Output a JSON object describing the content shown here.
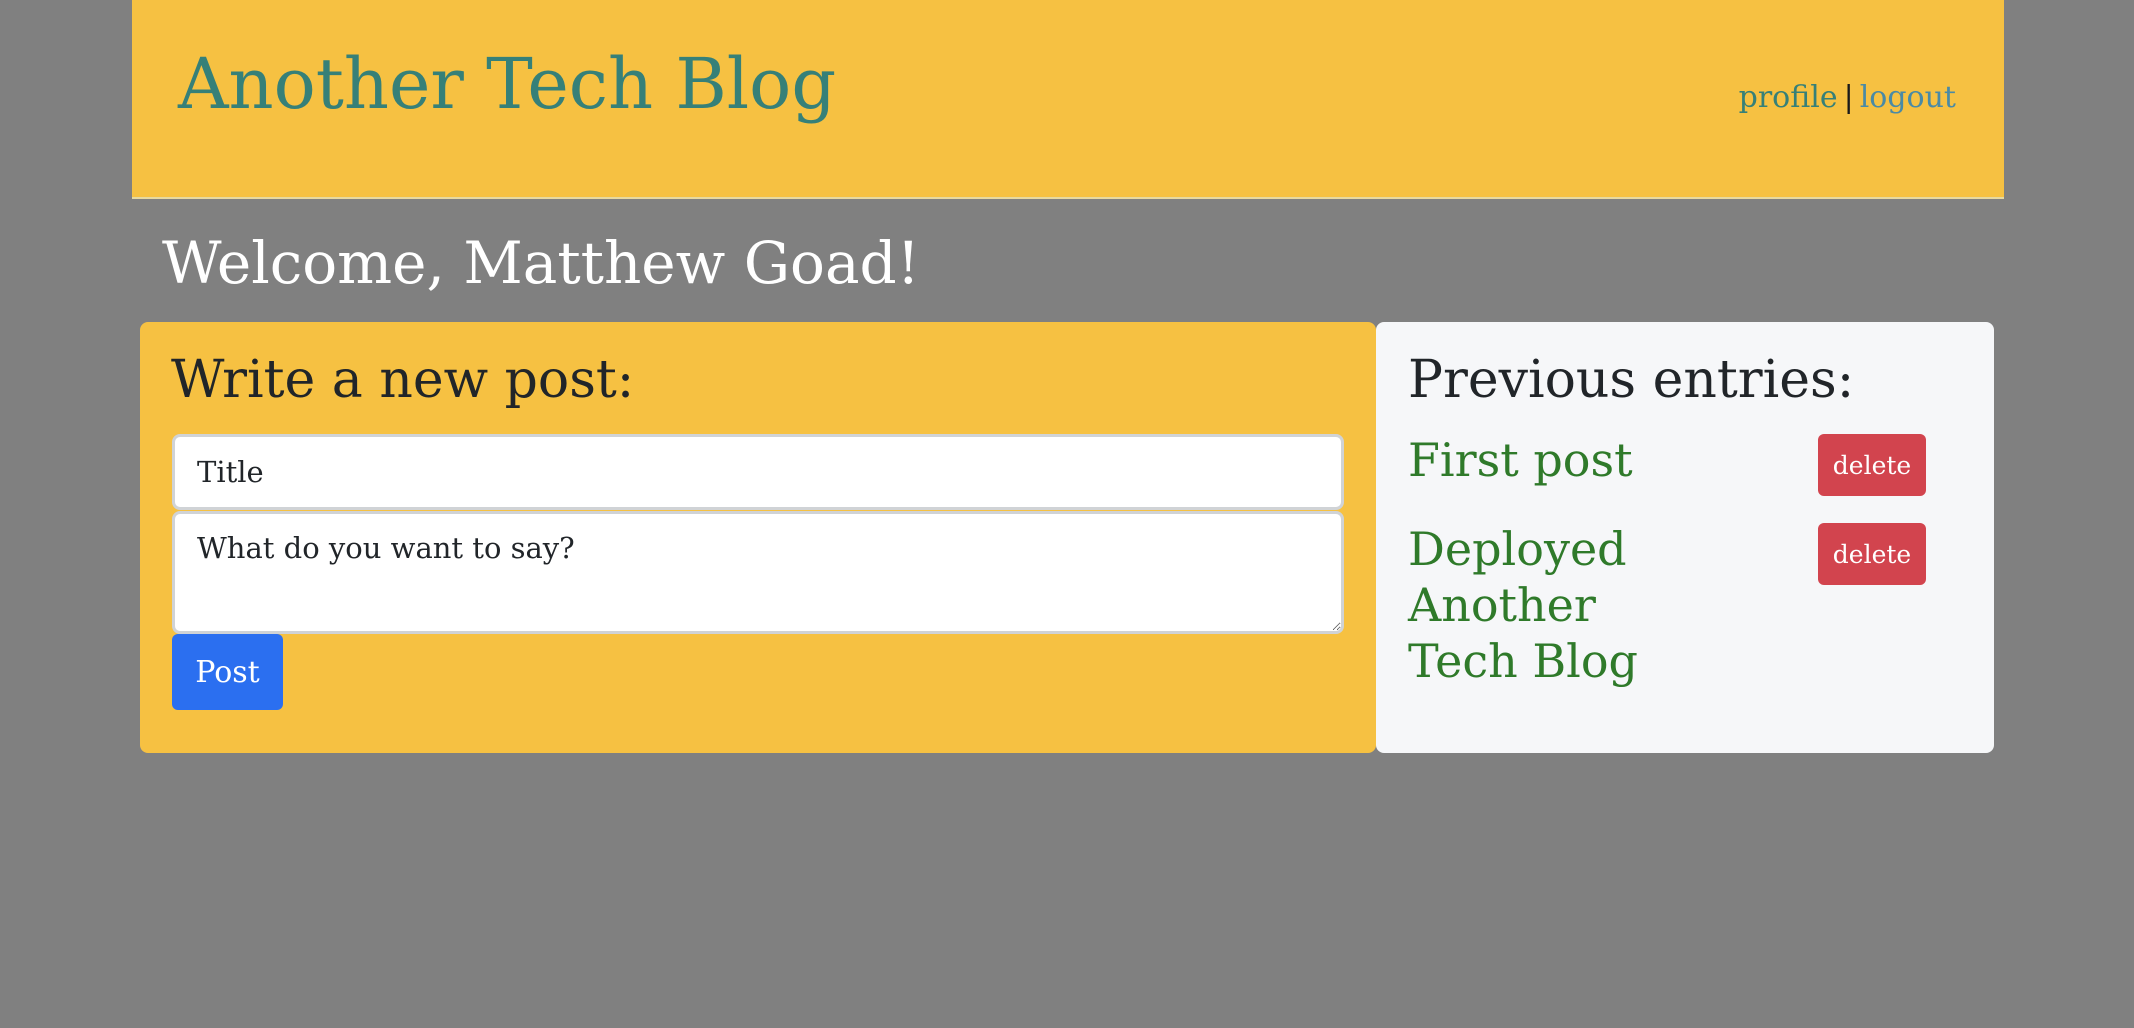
{
  "header": {
    "site_title": "Another Tech Blog",
    "nav": {
      "profile_label": "profile",
      "separator": "|",
      "logout_label": "logout"
    }
  },
  "welcome": {
    "text": "Welcome, Matthew Goad!"
  },
  "new_post": {
    "heading": "Write a new post:",
    "title_placeholder": "Title",
    "body_placeholder": "What do you want to say?",
    "submit_label": "Post"
  },
  "previous_entries": {
    "heading": "Previous entries:",
    "entries": [
      {
        "title": "First post",
        "delete_label": "delete"
      },
      {
        "title": "Deployed Another Tech Blog",
        "delete_label": "delete"
      }
    ]
  },
  "colors": {
    "background": "#808080",
    "accent_yellow": "#f6c142",
    "title_teal": "#368078",
    "entry_green": "#2f7a2a",
    "primary_blue": "#2b6ff0",
    "danger_red": "#d2444e",
    "panel_light": "#f6f7f9"
  }
}
